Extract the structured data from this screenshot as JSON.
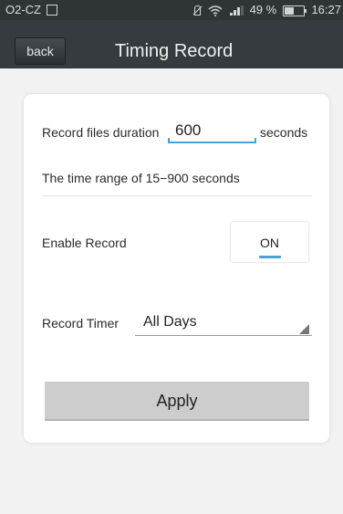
{
  "status_bar": {
    "carrier": "O2-CZ",
    "battery_percent": "49 %",
    "battery_level": 0.49,
    "time": "16:27",
    "icons": [
      "sim-card-icon",
      "mute-icon",
      "wifi-icon",
      "signal-icon",
      "battery-icon"
    ]
  },
  "header": {
    "back_label": "back",
    "title": "Timing Record",
    "background_color": "#353b3e"
  },
  "form": {
    "duration_label": "Record files duration",
    "duration_value": "600",
    "duration_unit": "seconds",
    "range_hint": "The time range of 15−900 seconds",
    "enable_label": "Enable Record",
    "enable_value": "ON",
    "timer_label": "Record Timer",
    "timer_value": "All Days",
    "apply_label": "Apply",
    "accent_color": "#4aa3d6"
  }
}
